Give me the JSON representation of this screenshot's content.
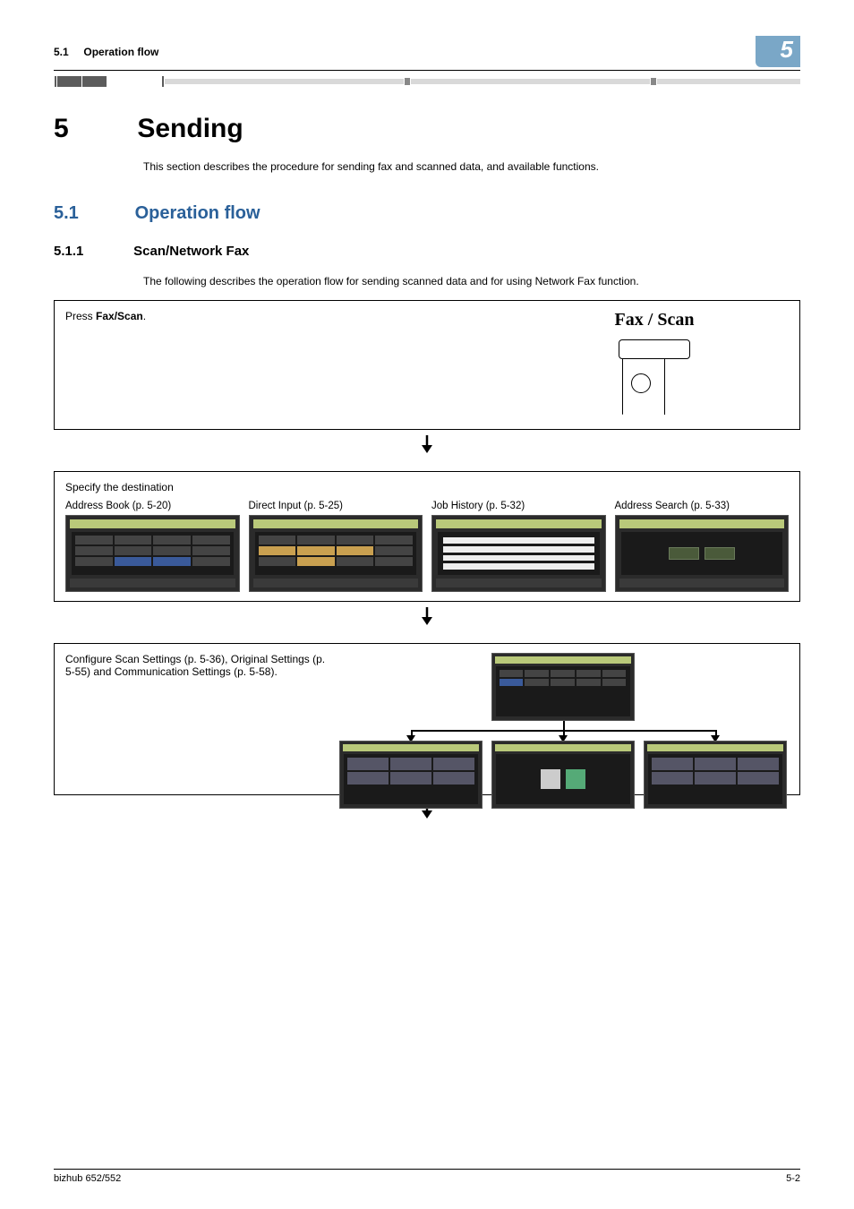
{
  "header": {
    "section_no": "5.1",
    "section_title": "Operation flow",
    "chapter_tab": "5"
  },
  "chapter": {
    "number": "5",
    "title": "Sending",
    "intro": "This section describes the procedure for sending fax and scanned data, and available functions."
  },
  "section": {
    "number": "5.1",
    "title": "Operation flow"
  },
  "subsection": {
    "number": "5.1.1",
    "title": "Scan/Network Fax",
    "intro": "The following describes the operation flow for sending scanned data and for using Network Fax function."
  },
  "step1": {
    "instruction_pre": "Press ",
    "instruction_bold": "Fax/Scan",
    "instruction_post": ".",
    "button_label": "Fax / Scan"
  },
  "step2": {
    "heading": "Specify the destination",
    "panels": [
      {
        "label": "Address Book (p. 5-20)"
      },
      {
        "label": "Direct Input (p. 5-25)"
      },
      {
        "label": "Job History (p. 5-32)"
      },
      {
        "label": "Address Search (p. 5-33)"
      }
    ]
  },
  "step3": {
    "text": "Configure Scan Settings (p. 5-36), Original Settings (p. 5-55) and Communication Settings (p. 5-58)."
  },
  "footer": {
    "left": "bizhub 652/552",
    "right": "5-2"
  }
}
